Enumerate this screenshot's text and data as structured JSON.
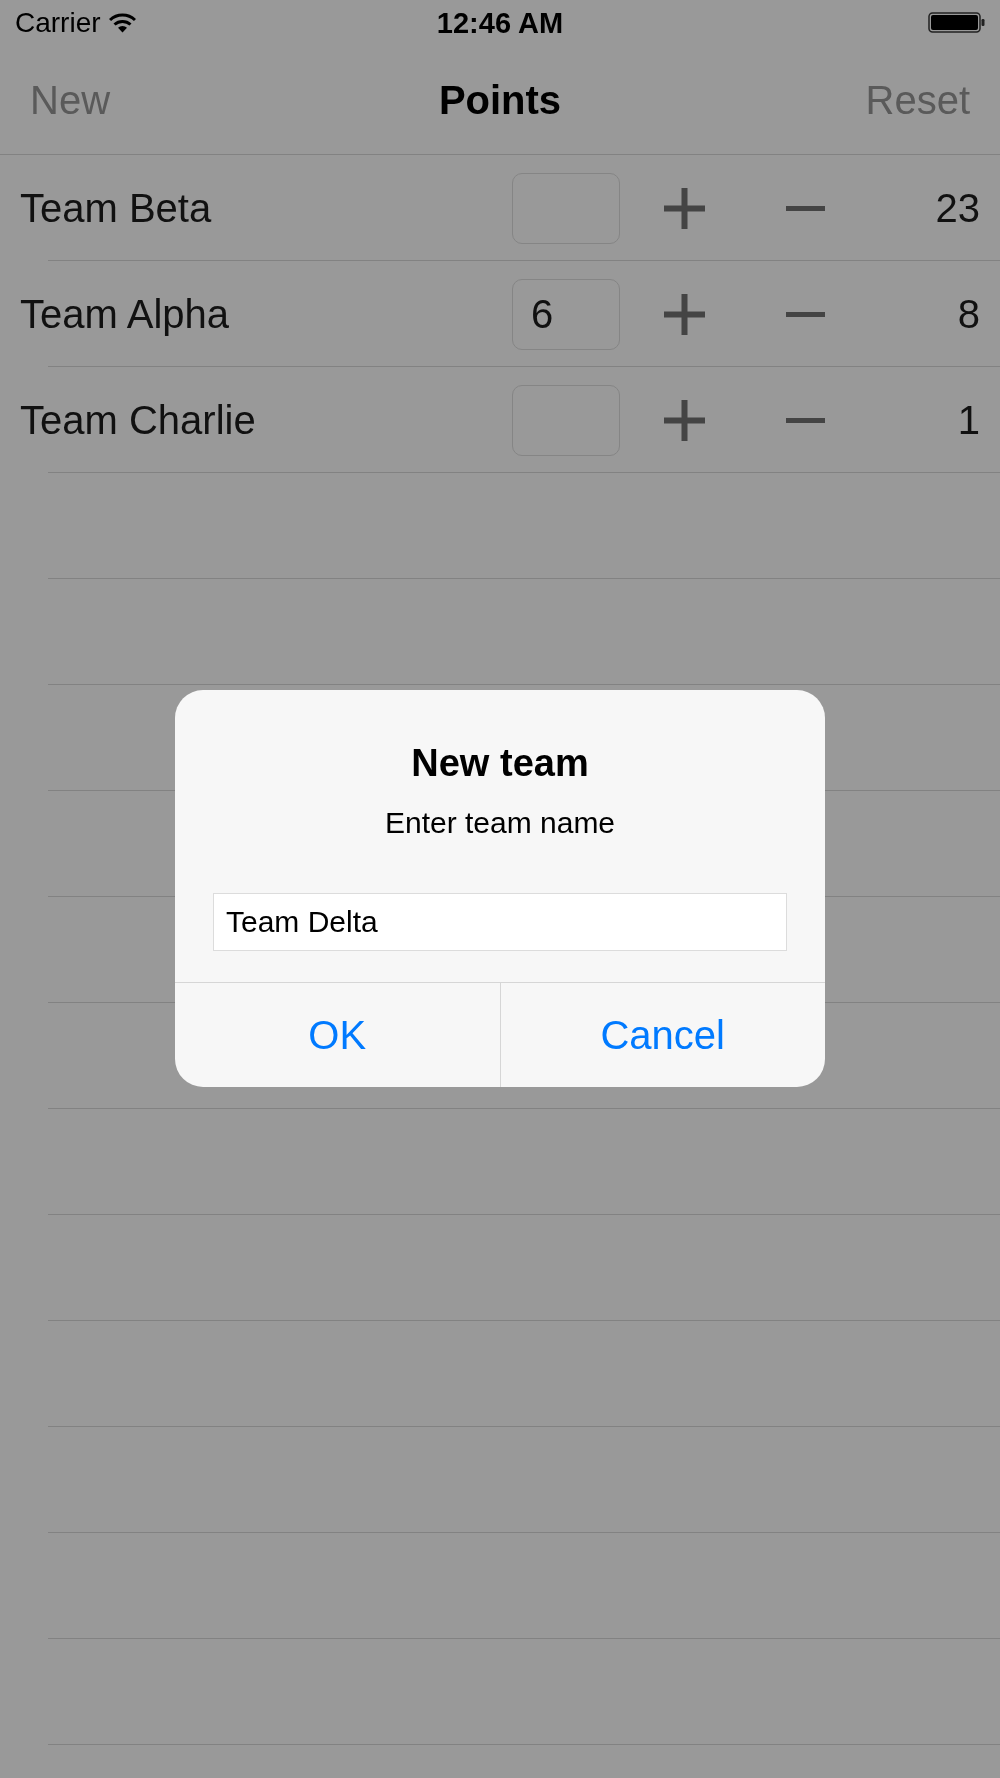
{
  "status_bar": {
    "carrier": "Carrier",
    "time": "12:46 AM"
  },
  "nav_bar": {
    "left_button": "New",
    "title": "Points",
    "right_button": "Reset"
  },
  "rows": [
    {
      "team": "Team Beta",
      "score": "23"
    },
    {
      "team": "Team Alpha",
      "entry": "6",
      "score": "8"
    },
    {
      "team": "Team Charlie",
      "score": "1"
    }
  ],
  "alert": {
    "title": "New team",
    "message": "Enter team name",
    "field_value": "Team Delta",
    "buttons": [
      "OK",
      "Cancel"
    ]
  }
}
